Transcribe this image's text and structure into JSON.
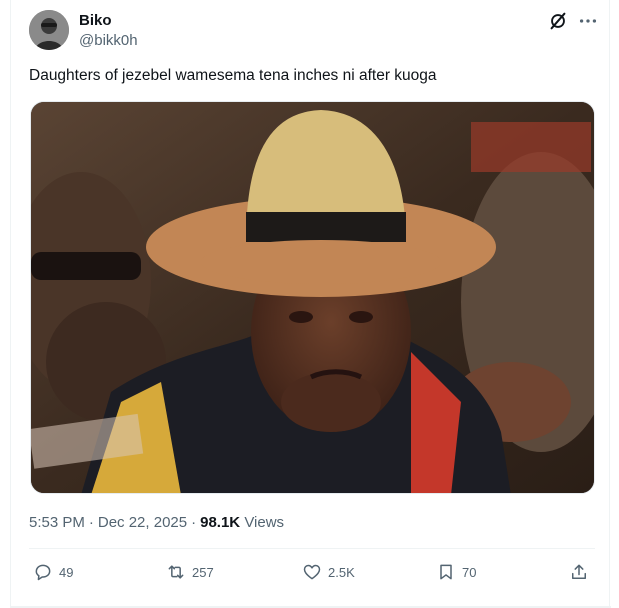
{
  "author": {
    "name": "Biko",
    "handle": "@bikk0h"
  },
  "header_icons": [
    "grok-icon",
    "more-horizontal-icon"
  ],
  "tweet": {
    "text": "Daughters of jezebel wamesema tena inches ni after kuoga"
  },
  "meta": {
    "time": "5:53 PM",
    "separator": "·",
    "date": "Dec 22, 2025",
    "views_count": "98.1K",
    "views_label": "Views"
  },
  "actions": {
    "replies": "49",
    "retweets": "257",
    "likes": "2.5K",
    "bookmarks": "70"
  },
  "colors": {
    "text_primary": "#0f1419",
    "text_secondary": "#536471",
    "border": "#eff3f4"
  }
}
